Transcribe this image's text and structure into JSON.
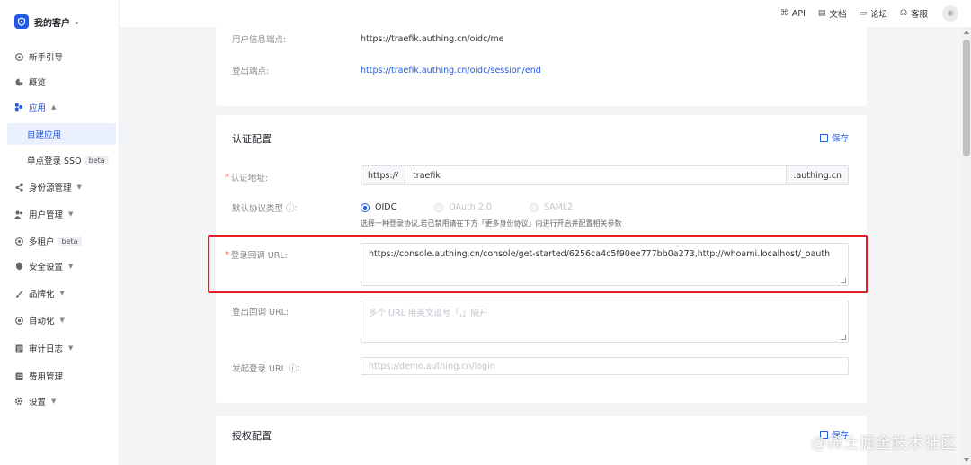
{
  "sidebar": {
    "brand": "我的客户",
    "items": [
      {
        "label": "新手引导",
        "icon": "guide-icon"
      },
      {
        "label": "概览",
        "icon": "pie-chart-icon"
      },
      {
        "label": "应用",
        "icon": "apps-icon"
      },
      {
        "label": "自建应用"
      },
      {
        "label": "单点登录 SSO",
        "badge": "beta"
      },
      {
        "label": "身份源管理",
        "icon": "share-icon"
      },
      {
        "label": "用户管理",
        "icon": "users-icon"
      },
      {
        "label": "多租户",
        "badge": "beta",
        "icon": "tenant-icon"
      },
      {
        "label": "安全设置",
        "icon": "shield-icon"
      },
      {
        "label": "品牌化",
        "icon": "brush-icon"
      },
      {
        "label": "自动化",
        "icon": "automation-icon"
      },
      {
        "label": "审计日志",
        "icon": "audit-icon"
      },
      {
        "label": "费用管理",
        "icon": "billing-icon"
      },
      {
        "label": "设置",
        "icon": "gear-icon"
      }
    ]
  },
  "topbar": {
    "links": [
      {
        "label": "API",
        "icon": "code-icon"
      },
      {
        "label": "文档",
        "icon": "doc-icon"
      },
      {
        "label": "论坛",
        "icon": "forum-icon"
      },
      {
        "label": "客服",
        "icon": "headset-icon"
      }
    ]
  },
  "endpoints": {
    "userinfo_label": "用户信息端点:",
    "userinfo_value": "https://traefik.authing.cn/oidc/me",
    "logout_label": "登出端点:",
    "logout_value": "https://traefik.authing.cn/oidc/session/end"
  },
  "auth_config": {
    "title": "认证配置",
    "save": "保存",
    "domain_label": "认证地址:",
    "domain_prefix": "https://",
    "domain_value": "traefik",
    "domain_suffix": ".authing.cn",
    "protocol_label": "默认协议类型",
    "protocols": [
      "OIDC",
      "OAuth 2.0",
      "SAML2"
    ],
    "protocol_selected": "OIDC",
    "protocol_help": "选择一种登录协议,若已禁用请在下方「更多身份协议」内进行开启并配置相关参数",
    "callback_label": "登录回调 URL:",
    "callback_value": "https://console.authing.cn/console/get-started/6256ca4c5f90ee777bb0a273,http://whoami.localhost/_oauth",
    "logout_callback_label": "登出回调 URL:",
    "logout_callback_placeholder": "多个 URL 用英文逗号「,」隔开",
    "initiate_label": "发起登录 URL",
    "initiate_placeholder": "https://demo.authing.cn/login"
  },
  "authz_config": {
    "title": "授权配置",
    "save": "保存"
  },
  "watermark": "@稀土掘金技术社区"
}
